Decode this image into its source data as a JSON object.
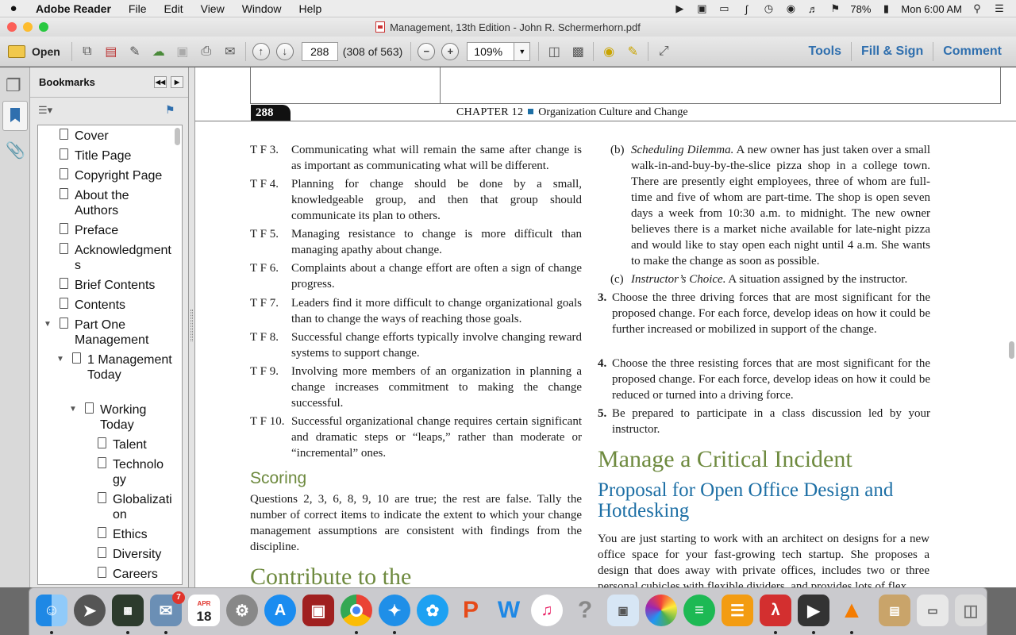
{
  "menubar": {
    "app_name": "Adobe Reader",
    "menus": [
      "File",
      "Edit",
      "View",
      "Window",
      "Help"
    ],
    "battery": "78%",
    "clock": "Mon 6:00 AM"
  },
  "window": {
    "title": "Management, 13th Edition - John R. Schermerhorn.pdf"
  },
  "toolbar": {
    "open_label": "Open",
    "page_value": "288",
    "page_count": "(308 of 563)",
    "zoom_value": "109%",
    "tools_label": "Tools",
    "fill_sign_label": "Fill & Sign",
    "comment_label": "Comment"
  },
  "bookmarks": {
    "title": "Bookmarks",
    "items": [
      "Cover",
      "Title Page",
      "Copyright Page",
      "About the Authors",
      "Preface",
      "Acknowledgments",
      "Brief Contents",
      "Contents",
      "Part One Management",
      "1 Management Today",
      "Working Today",
      "Talent",
      "Technology",
      "Globalization",
      "Ethics",
      "Diversity",
      "Careers"
    ]
  },
  "page": {
    "number": "288",
    "chapter_label": "CHAPTER 12",
    "chapter_title": "Organization Culture and Change",
    "tf_items": [
      {
        "label": "T F  3.",
        "text": "Communicating what will remain the same after change is as important as communicating what will be different."
      },
      {
        "label": "T F  4.",
        "text": "Planning for change should be done by a small, knowledgeable group, and then that group should communicate its plan to others."
      },
      {
        "label": "T F  5.",
        "text": "Managing resistance to change is more difficult than managing apathy about change."
      },
      {
        "label": "T F  6.",
        "text": "Complaints about a change effort are often a sign of change progress."
      },
      {
        "label": "T F  7.",
        "text": "Leaders find it more difficult to change organizational goals than to change the ways of reaching those goals."
      },
      {
        "label": "T F  8.",
        "text": "Successful change efforts typically involve changing reward systems to support change."
      },
      {
        "label": "T F  9.",
        "text": "Involving more members of an organization in planning a change increases commitment to making the change successful."
      },
      {
        "label": "T F 10.",
        "text": "Successful organizational change requires certain significant and dramatic steps or “leaps,” rather than moderate or “incremental” ones."
      }
    ],
    "scoring_heading": "Scoring",
    "scoring_text": "Questions 2, 3, 6, 8, 9, 10 are true; the rest are false. Tally the number of correct items to indicate the extent to which your change management assumptions are consistent with findings from the discipline.",
    "contribute_heading": "Contribute to the",
    "scheduling": {
      "lead": "(b)",
      "italic": "Scheduling Dilemma.",
      "text": " A new owner has just taken over a small walk-in-and-buy-by-the-slice pizza shop in a college town. There are presently eight employees, three of whom are full-time and five of whom are part-time. The shop is open seven days a week from 10:30 a.m. to midnight. The new owner believes there is a market niche available for late-night pizza and would like to stay open each night until 4 a.m. She wants to make the change as soon as possible."
    },
    "instructor": {
      "lead": "(c)",
      "italic": "Instructor’s Choice.",
      "text": " A situation assigned by the instructor."
    },
    "numbered": [
      {
        "num": "3.",
        "text": "Choose the three driving forces that are most significant for the proposed change. For each force, develop ideas on how it could be further increased or mobilized in support of the change."
      },
      {
        "num": "4.",
        "text": "Choose the three resisting forces that are most significant for the proposed change. For each force, develop ideas on how it could be reduced or turned into a driving force."
      },
      {
        "num": "5.",
        "text": "Be prepared to participate in a class discussion led by your instructor."
      }
    ],
    "critical_heading": "Manage a Critical Incident",
    "proposal_heading": "Proposal for Open Office Design and Hotdesking",
    "proposal_text": "You are just starting to work with an architect on designs for a new office space for your fast-growing tech startup. She proposes a design that does away with private offices, includes two or three personal cubicles with flexible dividers, and provides lots of flex"
  },
  "dock": {
    "calendar_month": "APR",
    "calendar_day": "18",
    "mail_badge": "7"
  }
}
